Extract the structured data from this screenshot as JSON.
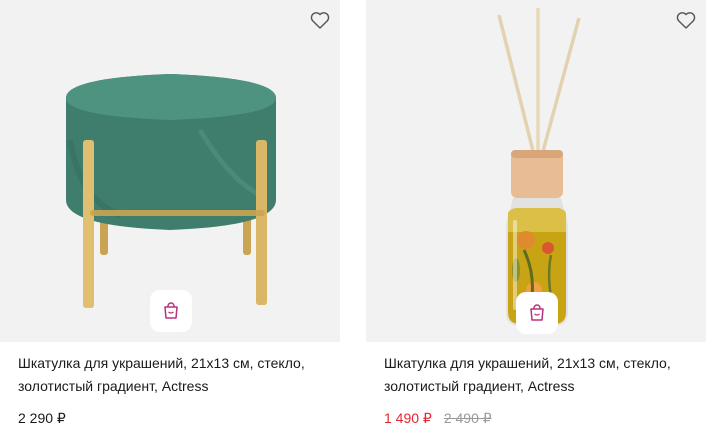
{
  "products": [
    {
      "title": "Шкатулка для украшений, 21x13 см, стекло, золотистый градиент, Actress",
      "price": "2 290 ₽",
      "image": "green-velvet-pouf",
      "favorite_icon": "heart-outline-icon",
      "cart_icon": "shopping-bag-icon"
    },
    {
      "title": "Шкатулка для украшений, 21x13 см, стекло, золотистый градиент, Actress",
      "price": "1 490 ₽",
      "old_price": "2 490 ₽",
      "image": "reed-diffuser-bottle",
      "favorite_icon": "heart-outline-icon",
      "cart_icon": "shopping-bag-icon"
    }
  ],
  "colors": {
    "sale_price": "#e3262f",
    "old_price": "#9a9a9a",
    "card_bg": "#f2f2f2"
  }
}
